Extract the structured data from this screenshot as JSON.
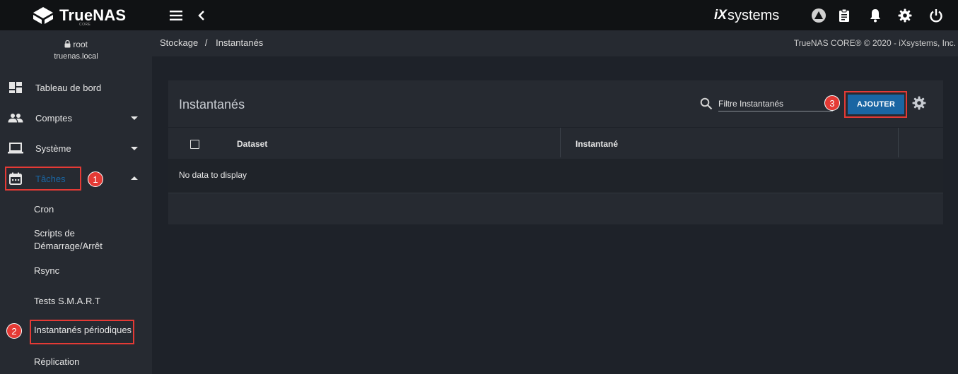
{
  "topbar": {
    "brand": "TrueNAS",
    "brand_sub": "CORE",
    "vendor_ix": "iX",
    "vendor_rest": "systems"
  },
  "user": {
    "name": "root",
    "host": "truenas.local"
  },
  "sidebar": {
    "items": [
      {
        "label": "Tableau de bord",
        "icon": "dashboard-icon"
      },
      {
        "label": "Comptes",
        "icon": "people-icon"
      },
      {
        "label": "Système",
        "icon": "laptop-icon"
      },
      {
        "label": "Tâches",
        "icon": "calendar-icon"
      }
    ],
    "subitems": [
      {
        "label": "Cron"
      },
      {
        "label": "Scripts de Démarrage/Arrêt"
      },
      {
        "label": "Rsync"
      },
      {
        "label": "Tests S.M.A.R.T"
      },
      {
        "label": "Instantanés périodiques"
      },
      {
        "label": "Réplication"
      }
    ]
  },
  "breadcrumb": {
    "parent": "Stockage",
    "separator": "/",
    "current": "Instantanés"
  },
  "copyright": "TrueNAS CORE® © 2020 - iXsystems, Inc.",
  "card": {
    "title": "Instantanés",
    "filter_placeholder": "Filtre Instantanés",
    "add_label": "AJOUTER",
    "columns": [
      "Dataset",
      "Instantané"
    ],
    "empty_text": "No data to display"
  },
  "annotations": {
    "badge_1": "1",
    "badge_2": "2",
    "badge_3": "3",
    "color": "#e43a35"
  },
  "colors": {
    "accent": "#1a66a3",
    "active_nav": "#1a66a3",
    "topbar": "#101214",
    "sidebar": "#262a31",
    "content_bg": "#1e2229"
  }
}
